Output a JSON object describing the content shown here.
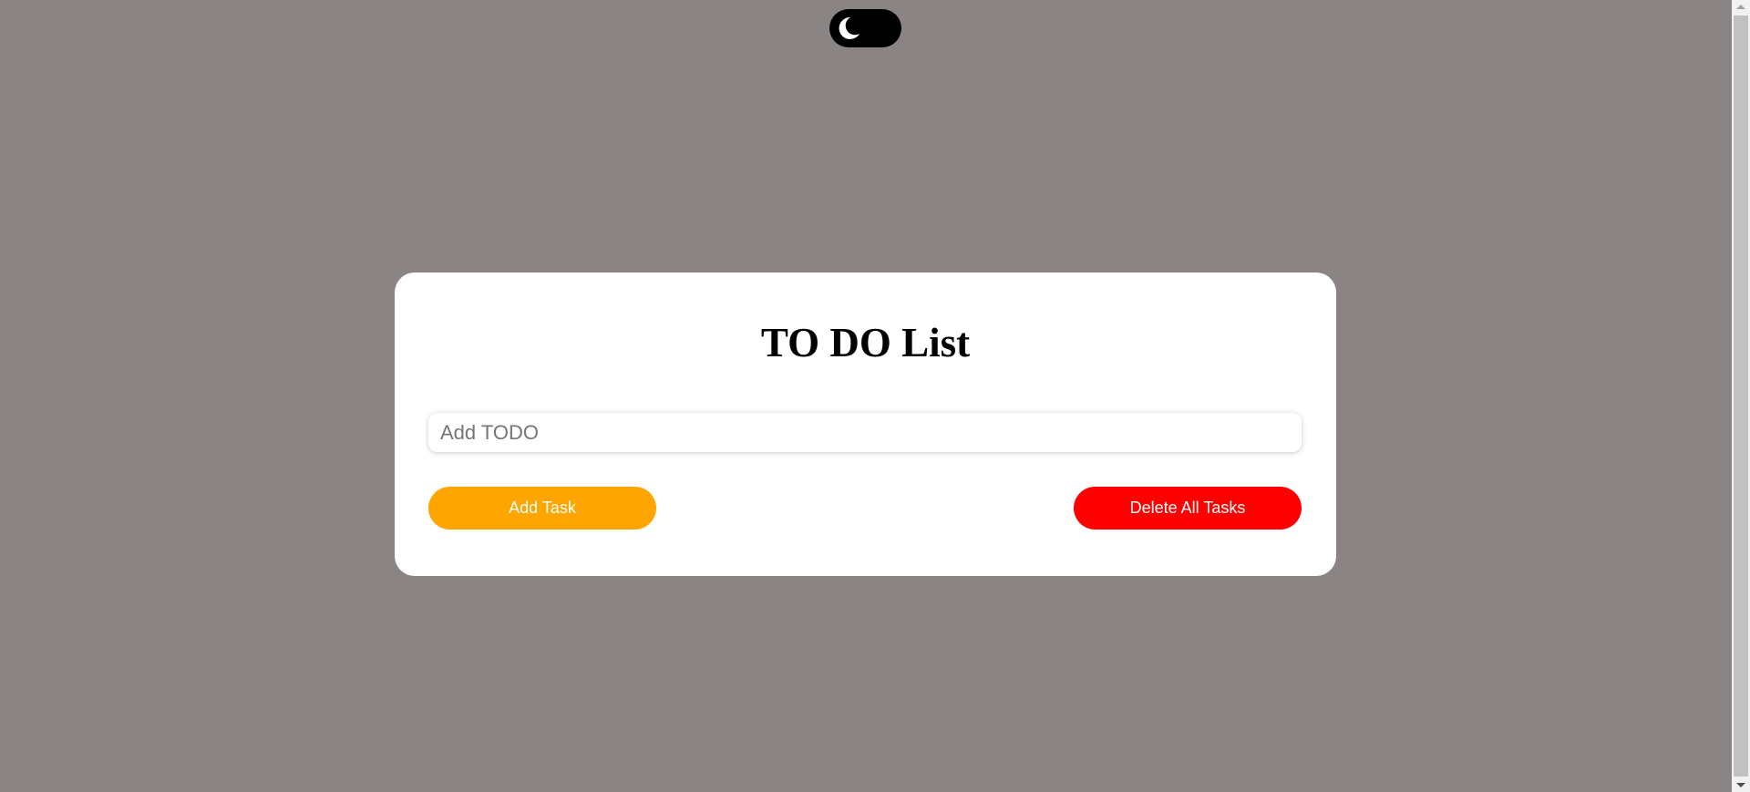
{
  "theme_toggle": {
    "icon": "moon-icon",
    "background_color": "#000000",
    "icon_color": "#ffffff"
  },
  "card": {
    "title": "TO DO List",
    "input": {
      "placeholder": "Add TODO",
      "value": ""
    },
    "add_button_label": "Add Task",
    "delete_button_label": "Delete All Tasks"
  },
  "colors": {
    "page_background": "#8a8484",
    "card_background": "#ffffff",
    "add_button": "#ffa500",
    "delete_button": "#ff0000"
  }
}
